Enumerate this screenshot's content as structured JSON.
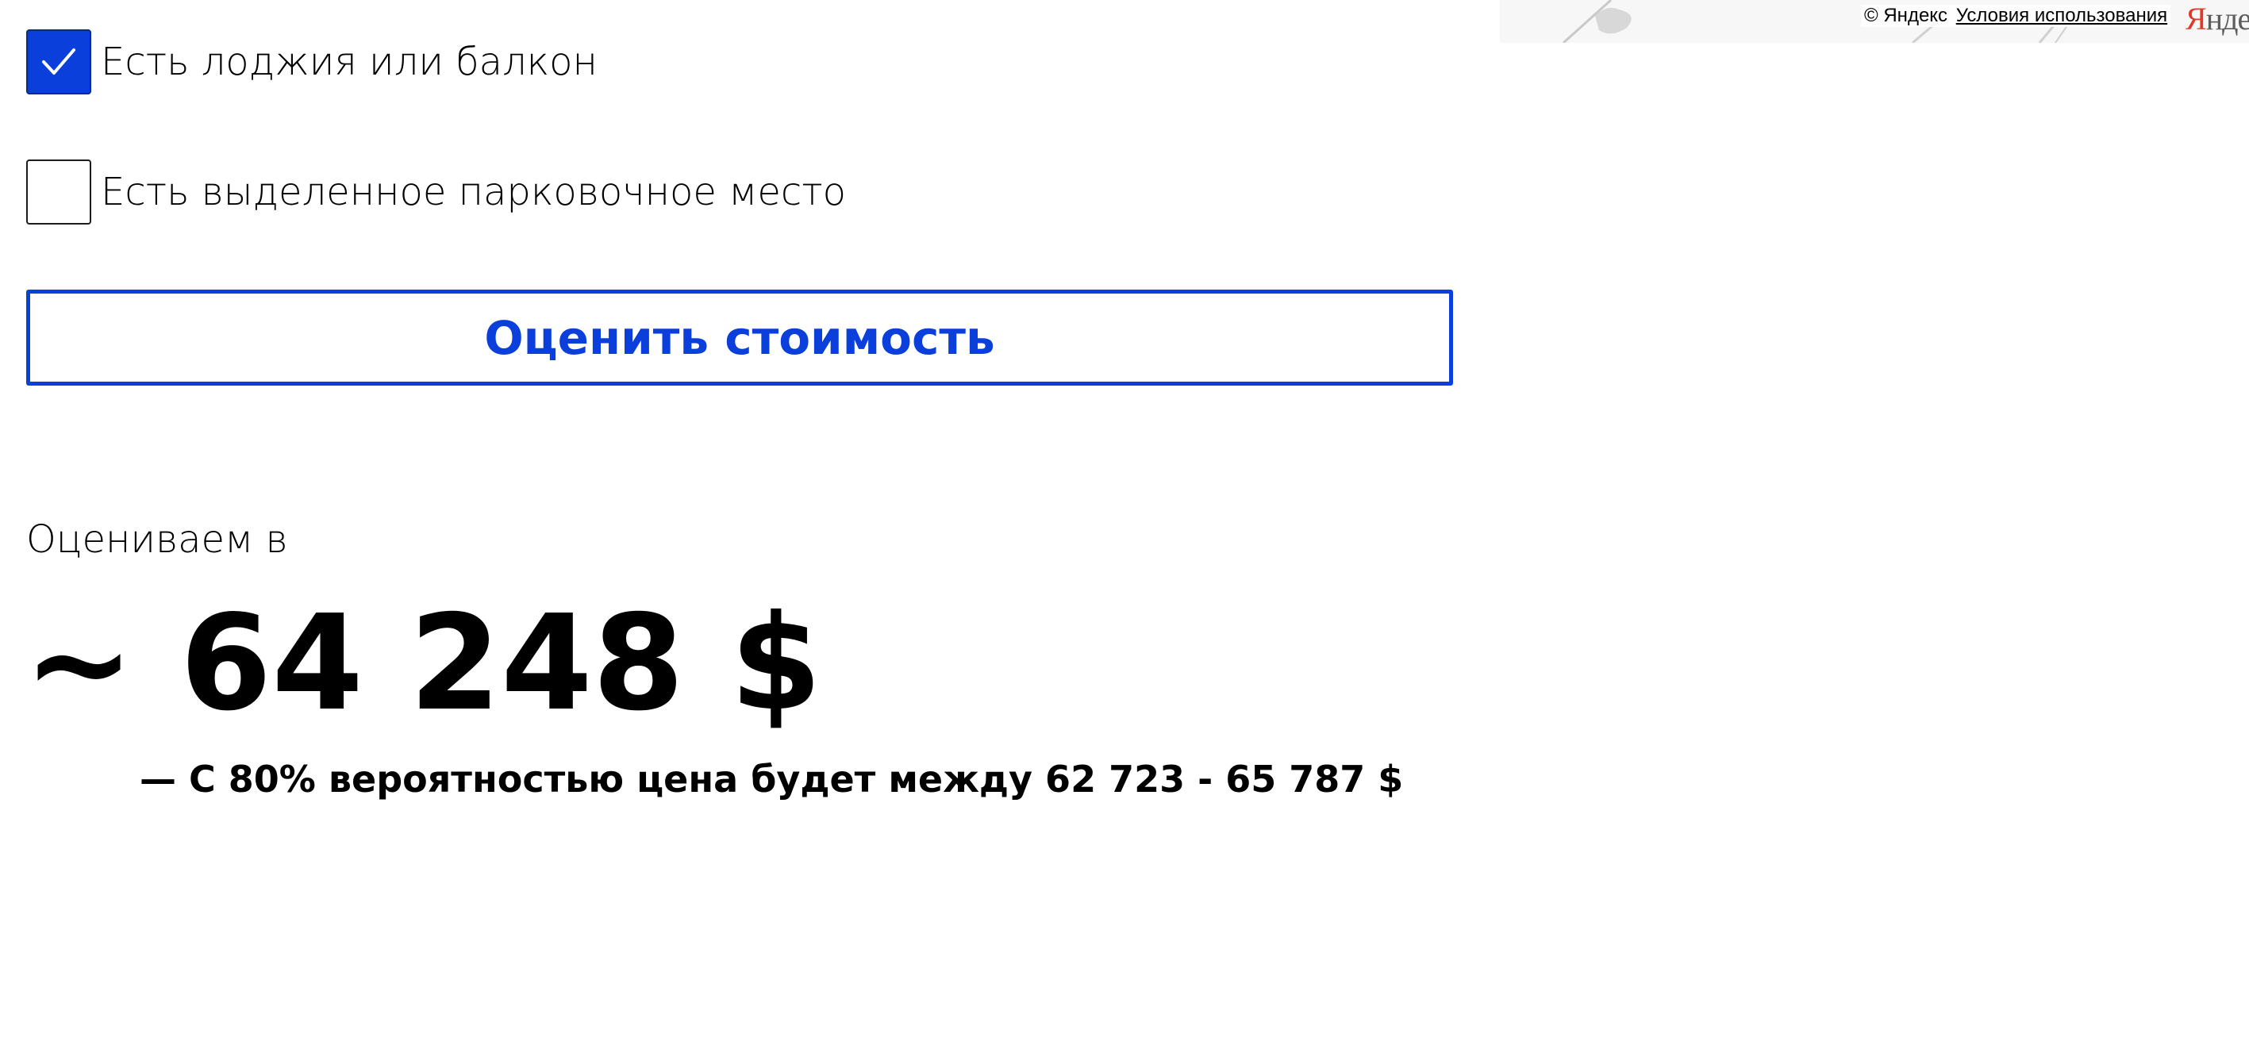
{
  "map": {
    "copyright": "© Яндекс",
    "terms_link": "Условия использования",
    "logo": "Яндекс"
  },
  "options": {
    "balcony": {
      "label": "Есть лоджия или балкон",
      "checked": true
    },
    "parking": {
      "label": "Есть выделенное парковочное место",
      "checked": false
    }
  },
  "estimate_button": {
    "label": "Оценить стоимость"
  },
  "result": {
    "caption": "Оцениваем в",
    "price": "~ 64 248 $",
    "range": "— С 80% вероятностью цена будет между 62 723 - 65 787 $"
  },
  "colors": {
    "accent": "#0b3fdc",
    "text": "#000000",
    "background": "#ffffff"
  }
}
